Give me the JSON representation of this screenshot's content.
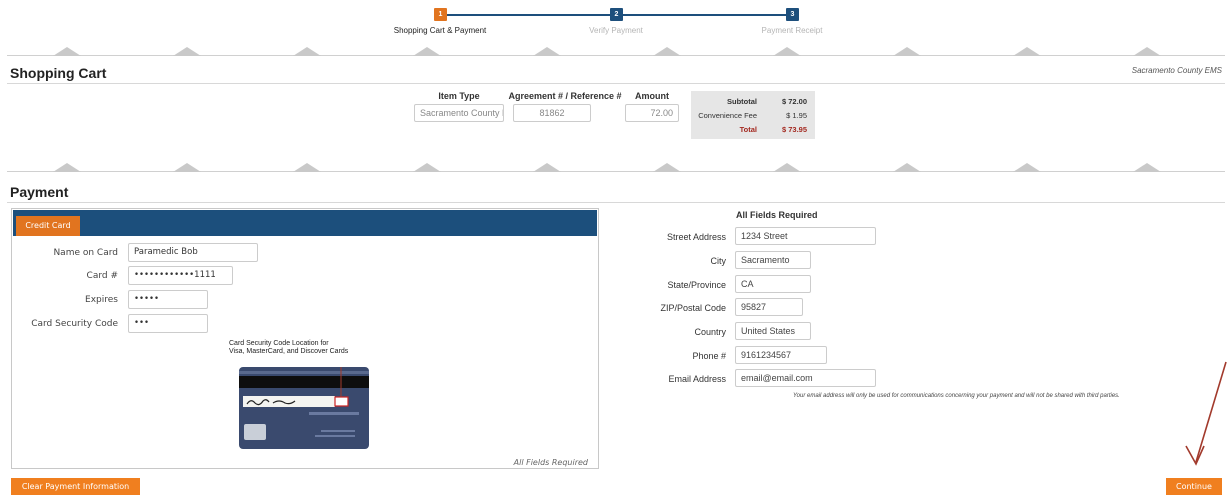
{
  "steps": [
    {
      "num": "1",
      "label": "Shopping Cart & Payment",
      "state": "active"
    },
    {
      "num": "2",
      "label": "Verify Payment",
      "state": "todo"
    },
    {
      "num": "3",
      "label": "Payment Receipt",
      "state": "todo"
    }
  ],
  "cart": {
    "title": "Shopping Cart",
    "org": "Sacramento County EMS",
    "headers": {
      "item_type": "Item Type",
      "reference": "Agreement # / Reference #",
      "amount": "Amount"
    },
    "item_type": "Sacramento County EMS",
    "reference": "81862",
    "amount": "72.00",
    "totals": {
      "subtotal_label": "Subtotal",
      "subtotal": "$ 72.00",
      "fee_label": "Convenience Fee",
      "fee": "$ 1.95",
      "total_label": "Total",
      "total": "$ 73.95"
    }
  },
  "payment": {
    "title": "Payment",
    "tab": "Credit Card",
    "fields": {
      "name_label": "Name on Card",
      "name": "Paramedic Bob",
      "card_label": "Card #",
      "card": "••••••••••••1111",
      "expires_label": "Expires",
      "expires": "•••••",
      "csc_label": "Card Security Code",
      "csc": "•••"
    },
    "csc_caption_1": "Card Security Code Location for",
    "csc_caption_2": "Visa, MasterCard, and Discover Cards",
    "footer": "All Fields Required"
  },
  "address": {
    "title": "All Fields Required",
    "street_label": "Street Address",
    "street": "1234 Street",
    "city_label": "City",
    "city": "Sacramento",
    "state_label": "State/Province",
    "state": "CA",
    "zip_label": "ZIP/Postal Code",
    "zip": "95827",
    "country_label": "Country",
    "country": "United States",
    "phone_label": "Phone #",
    "phone": "9161234567",
    "email_label": "Email Address",
    "email": "email@email.com",
    "email_note": "Your email address will only be used for communications concerning your payment and will not be shared with third parties."
  },
  "buttons": {
    "clear": "Clear Payment Information",
    "continue": "Continue"
  },
  "colors": {
    "accent": "#f07f1f",
    "brand": "#1c4f7c",
    "total_red": "#a3281f",
    "annotation": "#a23a2c"
  }
}
